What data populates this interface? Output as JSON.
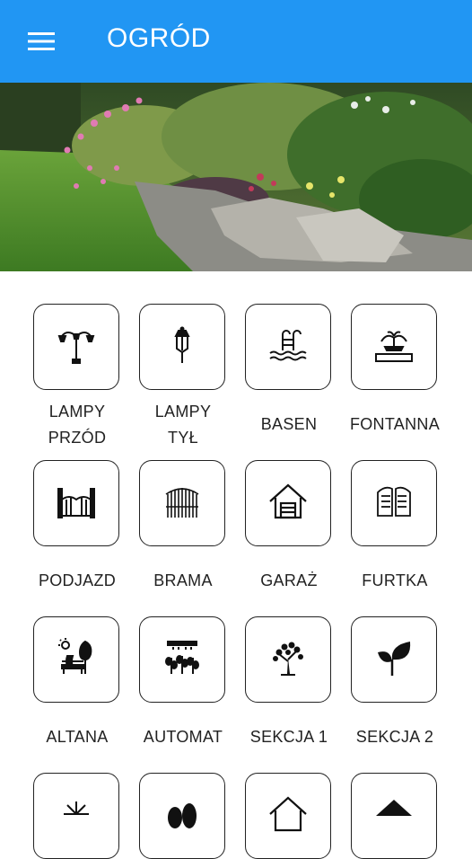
{
  "appbar": {
    "title": "OGRÓD",
    "menu_icon": "hamburger-menu-icon",
    "color": "#2196f3"
  },
  "hero": {
    "description_icon": "garden-photo"
  },
  "tiles": [
    {
      "line1": "LAMPY",
      "line2": "PRZÓD",
      "icon": "street-lamp-icon"
    },
    {
      "line1": "LAMPY",
      "line2": "TYŁ",
      "icon": "lantern-icon"
    },
    {
      "line1": "BASEN",
      "line2": "",
      "icon": "pool-icon"
    },
    {
      "line1": "FONTANNA",
      "line2": "",
      "icon": "fountain-icon"
    },
    {
      "line1": "PODJAZD",
      "line2": "",
      "icon": "driveway-gate-icon"
    },
    {
      "line1": "BRAMA",
      "line2": "",
      "icon": "gate-icon"
    },
    {
      "line1": "GARAŻ",
      "line2": "",
      "icon": "garage-icon"
    },
    {
      "line1": "FURTKA",
      "line2": "",
      "icon": "wicket-door-icon"
    },
    {
      "line1": "ALTANA",
      "line2": "",
      "icon": "gazebo-icon"
    },
    {
      "line1": "AUTOMAT",
      "line2": "",
      "icon": "sprinkler-icon"
    },
    {
      "line1": "SEKCJA 1",
      "line2": "",
      "icon": "tree-icon"
    },
    {
      "line1": "SEKCJA 2",
      "line2": "",
      "icon": "leaf-icon"
    },
    {
      "line1": "",
      "line2": "",
      "icon": "fireworks-icon"
    },
    {
      "line1": "",
      "line2": "",
      "icon": "shrub-icon"
    },
    {
      "line1": "",
      "line2": "",
      "icon": "house-icon"
    },
    {
      "line1": "",
      "line2": "",
      "icon": "roof-icon"
    }
  ]
}
